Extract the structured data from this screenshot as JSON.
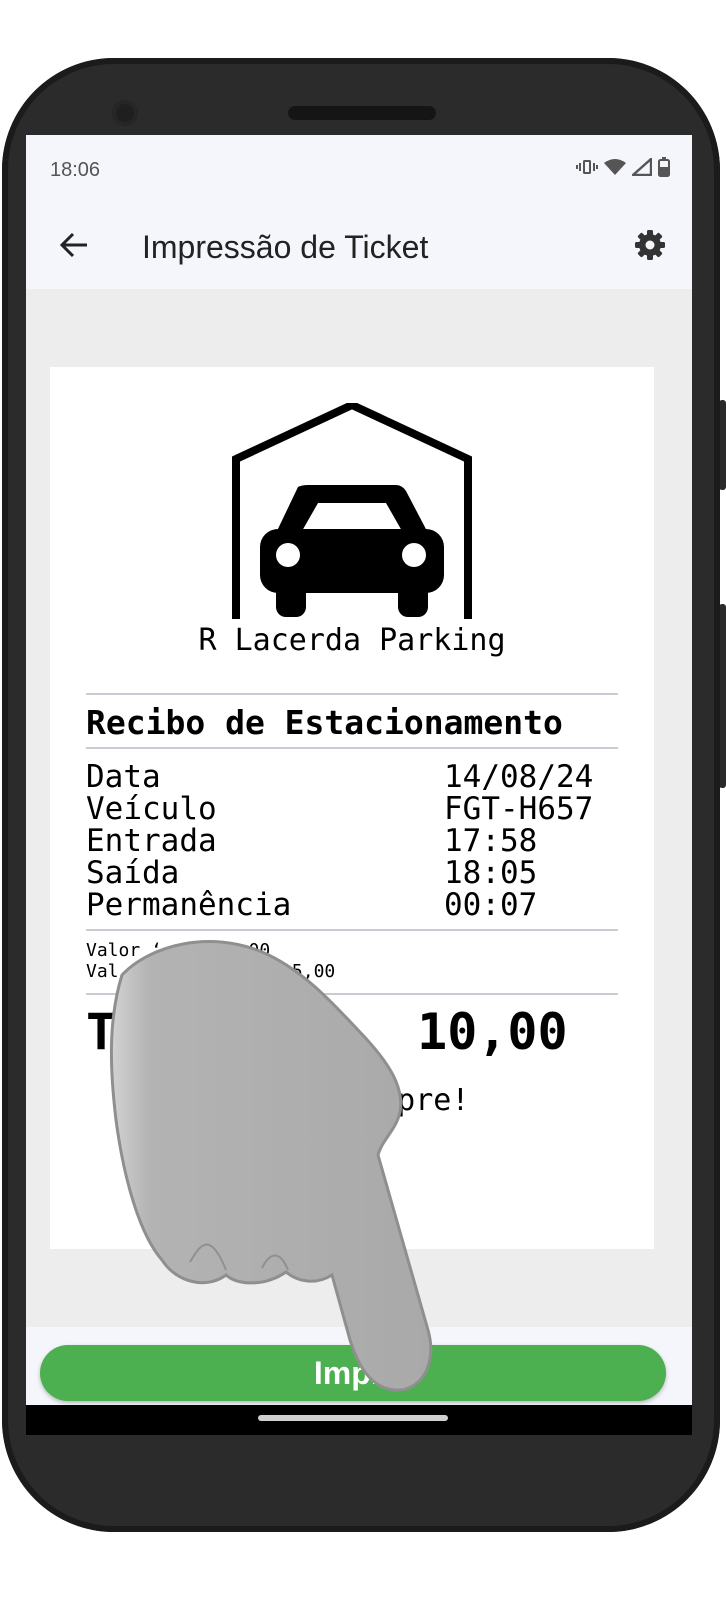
{
  "status_bar": {
    "time": "18:06",
    "icons": [
      "vibrate-icon",
      "wifi-icon",
      "signal-icon",
      "battery-icon"
    ]
  },
  "app_bar": {
    "title": "Impressão de Ticket",
    "back_icon": "arrow-left-icon",
    "settings_icon": "gear-icon"
  },
  "receipt": {
    "company_name": "R Lacerda Parking",
    "logo_icon": "garage-car-icon",
    "title": "Recibo de Estacionamento",
    "rows": [
      {
        "label": "Data",
        "value": "14/08/24"
      },
      {
        "label": "Veículo",
        "value": "FGT-H657"
      },
      {
        "label": "Entrada",
        "value": "17:58"
      },
      {
        "label": "Saída",
        "value": "18:05"
      },
      {
        "label": "Permanência",
        "value": "00:07"
      }
    ],
    "fee_lines": [
      "Valor ‘    $10,00",
      "Val      cional: R$5,00"
    ],
    "total_text": "T      $:  10,00",
    "thanks": "        mpre!"
  },
  "actions": {
    "print_label": "Impri"
  },
  "colors": {
    "accent": "#4caf50",
    "appbar_bg": "#f4f6fc",
    "content_bg": "#ededed"
  },
  "overlay": {
    "icon": "pointing-hand-icon"
  }
}
